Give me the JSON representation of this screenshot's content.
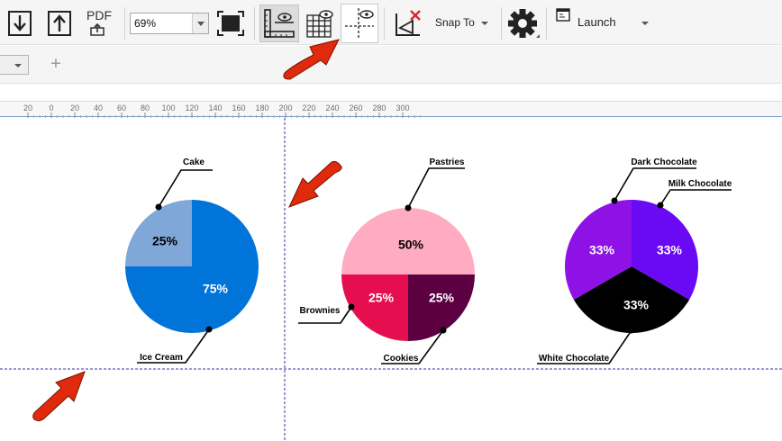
{
  "toolbar": {
    "import_icon": "import-arrow-down-icon",
    "export_icon": "export-arrow-up-icon",
    "pdf_label": "PDF",
    "zoom_value": "69%",
    "full_screen_icon": "full-screen-icon",
    "rulers_icon": "rulers-icon",
    "grid_icon": "grid-icon",
    "guidelines_icon": "guidelines-icon",
    "snap_off_icon": "snap-off-icon",
    "snap_to_label": "Snap To",
    "options_icon": "gear-icon",
    "launch_label": "Launch"
  },
  "page_bar": {
    "add_label": "+"
  },
  "ruler": {
    "ticks": [
      "20",
      "0",
      "20",
      "40",
      "60",
      "80",
      "100",
      "120",
      "140",
      "160",
      "180",
      "200",
      "220",
      "240",
      "260",
      "280",
      "300"
    ]
  },
  "colors": {
    "cake": "#7FA8D8",
    "ice_cream": "#0074D9",
    "pastries": "#FFABC2",
    "brownies": "#E50E4E",
    "cookies": "#5C0042",
    "dark_chocolate": "#8E12E6",
    "milk_chocolate": "#6A0AF5",
    "white_chocolate": "#000000",
    "guide_line": "#3333AA",
    "annotation_arrow": "#E02A0E"
  },
  "chart_data": [
    {
      "type": "pie",
      "series": [
        {
          "label": "Cake",
          "value": 25,
          "display": "25%"
        },
        {
          "label": "Ice Cream",
          "value": 75,
          "display": "75%"
        }
      ]
    },
    {
      "type": "pie",
      "series": [
        {
          "label": "Pastries",
          "value": 50,
          "display": "50%"
        },
        {
          "label": "Brownies",
          "value": 25,
          "display": "25%"
        },
        {
          "label": "Cookies",
          "value": 25,
          "display": "25%"
        }
      ]
    },
    {
      "type": "pie",
      "series": [
        {
          "label": "Dark Chocolate",
          "value": 33.33,
          "display": "33%"
        },
        {
          "label": "Milk Chocolate",
          "value": 33.33,
          "display": "33%"
        },
        {
          "label": "White Chocolate",
          "value": 33.33,
          "display": "33%"
        }
      ]
    }
  ]
}
